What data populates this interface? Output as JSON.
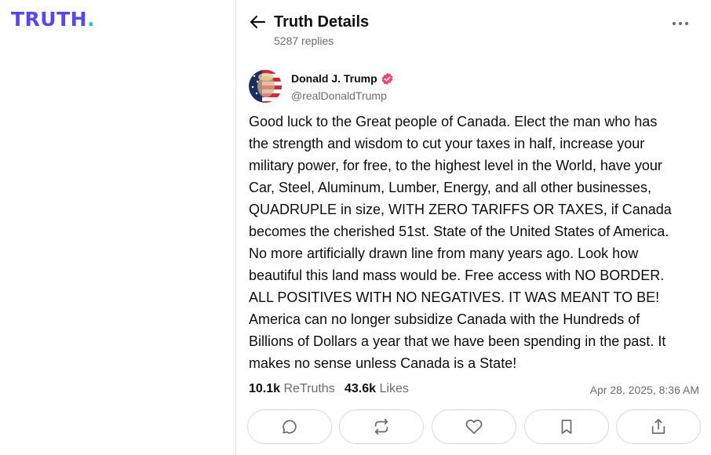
{
  "brand": {
    "logo_text": "TRUTH",
    "logo_dot": ".",
    "logo_color": "#5448ee",
    "dot_color": "#2ec4b6"
  },
  "header": {
    "title": "Truth Details",
    "replies": "5287 replies",
    "back_icon": "arrow-left-icon",
    "more_icon": "more-horizontal-icon"
  },
  "post": {
    "author_name": "Donald J. Trump",
    "author_handle": "@realDonaldTrump",
    "verified_color": "#ef476f",
    "text": "Good luck to the Great people of Canada. Elect the man who has\nthe strength and wisdom to cut your taxes in half, increase your\nmilitary power, for free, to the highest level in the World, have your\nCar, Steel, Aluminum, Lumber, Energy, and all other businesses,\nQUADRUPLE in size, WITH ZERO TARIFFS OR TAXES, if Canada\nbecomes the cherished 51st. State of the United States of America.\nNo more artificially drawn line from many years ago. Look how\nbeautiful this land mass would be. Free access with NO BORDER.\nALL POSITIVES WITH NO NEGATIVES. IT WAS MEANT TO BE!\nAmerica can no longer subsidize Canada with the Hundreds of\nBillions of Dollars a year that we have been spending in the past. It\nmakes no sense unless Canada is a State!",
    "retruths_count": "10.1k",
    "retruths_label": "ReTruths",
    "likes_count": "43.6k",
    "likes_label": "Likes",
    "timestamp": "Apr 28, 2025, 8:36 AM"
  },
  "actions": [
    {
      "name": "reply",
      "icon": "reply-bubble-icon"
    },
    {
      "name": "retruth",
      "icon": "repost-icon"
    },
    {
      "name": "like",
      "icon": "heart-icon"
    },
    {
      "name": "bookmark",
      "icon": "bookmark-icon"
    },
    {
      "name": "share",
      "icon": "share-icon"
    }
  ]
}
